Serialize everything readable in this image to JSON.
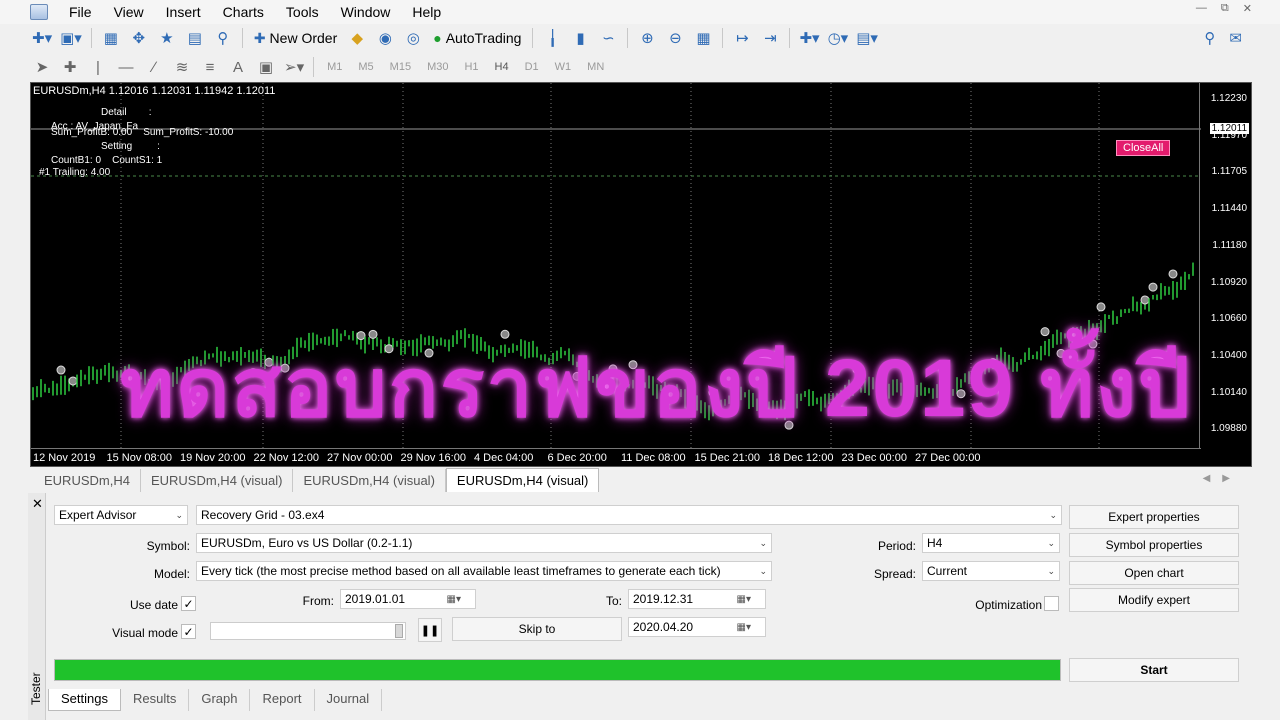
{
  "menu": [
    "File",
    "View",
    "Insert",
    "Charts",
    "Tools",
    "Window",
    "Help"
  ],
  "toolbar": {
    "new_order": "New Order",
    "autotrading": "AutoTrading"
  },
  "timeframes": [
    "M1",
    "M5",
    "M15",
    "M30",
    "H1",
    "H4",
    "D1",
    "W1",
    "MN"
  ],
  "active_timeframe": "H4",
  "chart": {
    "header": "EURUSDm,H4  1.12016 1.12031 1.11942 1.12011",
    "info_lines": [
      "Detail        :",
      "Acc : AV_Japan_Fa",
      "Sum_ProfitB: 0.00    Sum_ProfitS: -10.00",
      "Setting         :",
      "CountB1: 0    CountS1: 1",
      "#1 Trailing: 4.00"
    ],
    "overlay": "ทดสอบกราฟของปี 2019 ทั้งปี",
    "close_all": "CloseAll",
    "current_price": "1.12011",
    "price_ticks": [
      "1.12230",
      "1.11970",
      "1.11705",
      "1.11440",
      "1.11180",
      "1.10920",
      "1.10660",
      "1.10400",
      "1.10140",
      "1.09880"
    ],
    "time_ticks": [
      "12 Nov 2019",
      "15 Nov 08:00",
      "19 Nov 20:00",
      "22 Nov 12:00",
      "27 Nov 00:00",
      "29 Nov 16:00",
      "4 Dec 04:00",
      "6 Dec 20:00",
      "11 Dec 08:00",
      "15 Dec 21:00",
      "18 Dec 12:00",
      "23 Dec 00:00",
      "27 Dec 00:00"
    ]
  },
  "chart_tabs": [
    "EURUSDm,H4",
    "EURUSDm,H4 (visual)",
    "EURUSDm,H4 (visual)",
    "EURUSDm,H4 (visual)"
  ],
  "tester": {
    "type": "Expert Advisor",
    "expert": "Recovery Grid - 03.ex4",
    "symbol_label": "Symbol:",
    "symbol": "EURUSDm, Euro vs US Dollar (0.2-1.1)",
    "model_label": "Model:",
    "model": "Every tick (the most precise method based on all available least timeframes to generate each tick)",
    "use_date_label": "Use date",
    "from_label": "From:",
    "from": "2019.01.01",
    "to_label": "To:",
    "to": "2019.12.31",
    "visual_label": "Visual mode",
    "skip_to": "Skip to",
    "skip_date": "2020.04.20",
    "period_label": "Period:",
    "period": "H4",
    "spread_label": "Spread:",
    "spread": "Current",
    "optimization_label": "Optimization",
    "buttons": {
      "expert_props": "Expert properties",
      "symbol_props": "Symbol properties",
      "open_chart": "Open chart",
      "modify_expert": "Modify expert",
      "start": "Start"
    },
    "progress": 1.0,
    "side_label": "Tester",
    "bottom_tabs": [
      "Settings",
      "Results",
      "Graph",
      "Report",
      "Journal"
    ]
  }
}
